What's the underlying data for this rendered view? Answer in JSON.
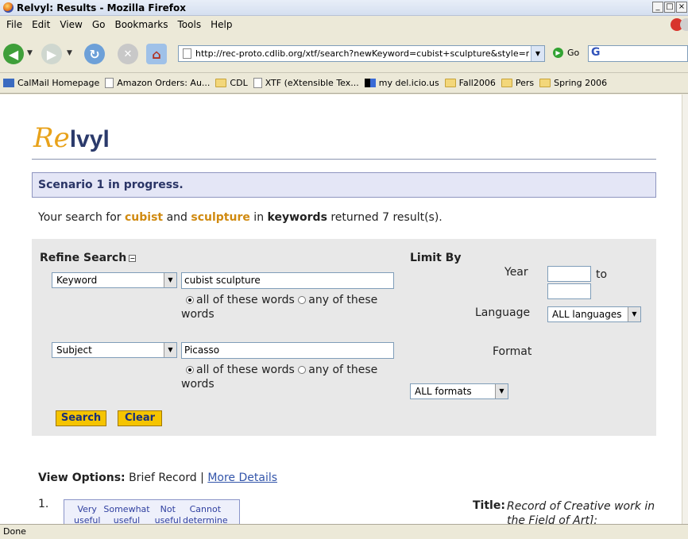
{
  "window": {
    "title": "Relvyl: Results - Mozilla Firefox"
  },
  "menu": [
    "File",
    "Edit",
    "View",
    "Go",
    "Bookmarks",
    "Tools",
    "Help"
  ],
  "nav": {
    "url": "http://rec-proto.cdlib.org/xtf/search?newKeyword=cubist+sculpture&style=melrec&br",
    "go_label": "Go",
    "google_letter": "G"
  },
  "bookmarks": [
    {
      "label": "CalMail Homepage",
      "icon": "mail-icon"
    },
    {
      "label": "Amazon Orders: Au...",
      "icon": "page-icon"
    },
    {
      "label": "CDL",
      "icon": "folder-icon"
    },
    {
      "label": "XTF (eXtensible Tex...",
      "icon": "page-icon"
    },
    {
      "label": "my del.icio.us",
      "icon": "delicious-icon"
    },
    {
      "label": "Fall2006",
      "icon": "folder-icon"
    },
    {
      "label": "Pers",
      "icon": "folder-icon"
    },
    {
      "label": "Spring 2006",
      "icon": "folder-icon"
    }
  ],
  "logo": {
    "part1": "Re",
    "part2": "lvyl"
  },
  "scenario": "Scenario 1 in progress.",
  "summary": {
    "prefix": "Your search for ",
    "term1": "cubist",
    "and": " and ",
    "term2": "sculpture",
    "in": " in ",
    "field": "keywords",
    "suffix": " returned 7 result(s)."
  },
  "refine": {
    "heading": "Refine Search",
    "collapse_glyph": "−",
    "row1": {
      "field": "Keyword",
      "value": "cubist sculpture"
    },
    "row2": {
      "field": "Subject",
      "value": "Picasso"
    },
    "radio_all": "all of these words",
    "radio_any": "any of these",
    "radio_wrap": "words",
    "search_button": "Search",
    "clear_button": "Clear"
  },
  "limit": {
    "heading": "Limit By",
    "year_label": "Year",
    "to_label": "to",
    "language_label": "Language",
    "language_value": "ALL languages",
    "format_label": "Format",
    "format_value": "ALL formats"
  },
  "view_options": {
    "label": "View Options:",
    "brief": "Brief Record",
    "sep": " | ",
    "more": "More Details"
  },
  "result": {
    "number": "1.",
    "ratings": [
      {
        "top": "Very",
        "bottom": "useful"
      },
      {
        "top": "Somewhat",
        "bottom": "useful"
      },
      {
        "top": "Not",
        "bottom": "useful"
      },
      {
        "top": "Cannot",
        "bottom": "determine"
      }
    ],
    "title_label": "Title:",
    "title_value": "Record of Creative work in the Field of Art]:"
  },
  "status": "Done"
}
